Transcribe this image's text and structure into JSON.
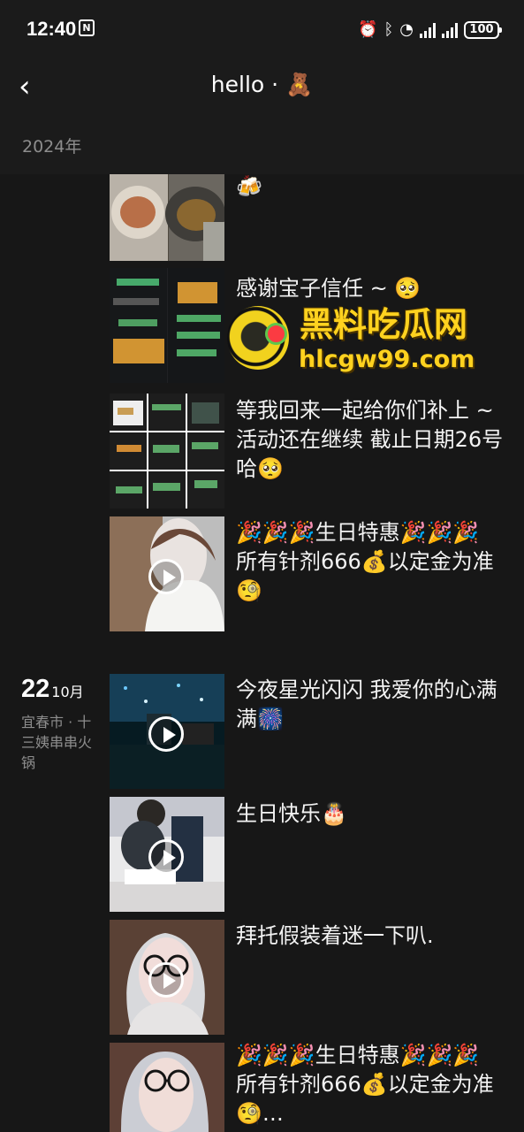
{
  "status": {
    "time": "12:40",
    "nfc": "N",
    "battery": "100"
  },
  "header": {
    "back_icon": "‹",
    "title": "hello · 🧸",
    "year": "2024年"
  },
  "timeline": {
    "date": {
      "day": "22",
      "month": "10月",
      "location": "宜春市 · 十三姨串串火锅"
    },
    "posts": [
      {
        "text": "🍻",
        "kind": "photo"
      },
      {
        "text": "感谢宝子信任 ~ 🥺",
        "kind": "chat"
      },
      {
        "text": "等我回来一起给你们补上 ~ 活动还在继续 截止日期26号哈🥺",
        "kind": "chat-grid"
      },
      {
        "text": "🎉🎉🎉生日特惠🎉🎉🎉\n所有针剂666💰以定金为准🧐",
        "kind": "video"
      },
      {
        "text": "今夜星光闪闪 我爱你的心满满🎆",
        "kind": "video"
      },
      {
        "text": "生日快乐🎂",
        "kind": "video"
      },
      {
        "text": "拜托假装着迷一下叭.",
        "kind": "video"
      },
      {
        "text": "🎉🎉🎉生日特惠🎉🎉🎉\n所有针剂666💰以定金为准🧐…",
        "kind": "video"
      }
    ]
  },
  "watermark": {
    "title": "黑料吃瓜网",
    "domain": "hlcgw99.com"
  }
}
